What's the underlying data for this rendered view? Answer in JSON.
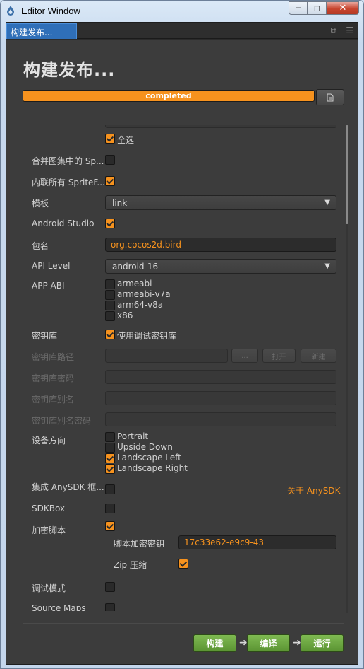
{
  "window": {
    "title": "Editor Window"
  },
  "tab": {
    "label": "构建发布..."
  },
  "page": {
    "title": "构建发布..."
  },
  "progress": {
    "label": "completed",
    "value": 1.0
  },
  "form": {
    "select_all_label": "全选",
    "merge_atlas": {
      "label": "合并图集中的 Sp...",
      "checked": false
    },
    "inline_spriteframes": {
      "label": "内联所有 SpriteF...",
      "checked": true
    },
    "template": {
      "label": "模板",
      "value": "link"
    },
    "android_studio": {
      "label": "Android Studio",
      "checked": true
    },
    "package_name": {
      "label": "包名",
      "value": "org.cocos2d.bird"
    },
    "api_level": {
      "label": "API Level",
      "value": "android-16"
    },
    "app_abi": {
      "label": "APP ABI",
      "options": [
        {
          "name": "armeabi",
          "checked": false
        },
        {
          "name": "armeabi-v7a",
          "checked": false
        },
        {
          "name": "arm64-v8a",
          "checked": false
        },
        {
          "name": "x86",
          "checked": false
        }
      ]
    },
    "keystore": {
      "label": "密钥库",
      "use_debug_label": "使用调试密钥库",
      "checked": true
    },
    "keystore_path": {
      "label": "密钥库路径",
      "browse_label": "...",
      "open_label": "打开",
      "new_label": "新建"
    },
    "keystore_password": {
      "label": "密钥库密码"
    },
    "keystore_alias": {
      "label": "密钥库别名"
    },
    "keystore_alias_password": {
      "label": "密钥库别名密码"
    },
    "orientation": {
      "label": "设备方向",
      "options": [
        {
          "name": "Portrait",
          "checked": false
        },
        {
          "name": "Upside Down",
          "checked": false
        },
        {
          "name": "Landscape Left",
          "checked": true
        },
        {
          "name": "Landscape Right",
          "checked": true
        }
      ]
    },
    "anysdk": {
      "label": "集成 AnySDK 框...",
      "checked": false,
      "link": "关于 AnySDK"
    },
    "sdkbox": {
      "label": "SDKBox",
      "checked": false
    },
    "encrypt_js": {
      "label": "加密脚本",
      "checked": true
    },
    "encrypt_key": {
      "label": "脚本加密密钥",
      "value": "17c33e62-e9c9-43"
    },
    "zip": {
      "label": "Zip 压缩",
      "checked": true
    },
    "debug": {
      "label": "调试模式",
      "checked": false
    },
    "source_maps": {
      "label": "Source Maps",
      "checked": false
    }
  },
  "footer": {
    "build_label": "构建",
    "compile_label": "编译",
    "run_label": "运行"
  },
  "colors": {
    "accent": "#f6921e",
    "tab": "#2f6fb8",
    "button_green": "#6aa33f",
    "panel": "#3c3c3c"
  }
}
